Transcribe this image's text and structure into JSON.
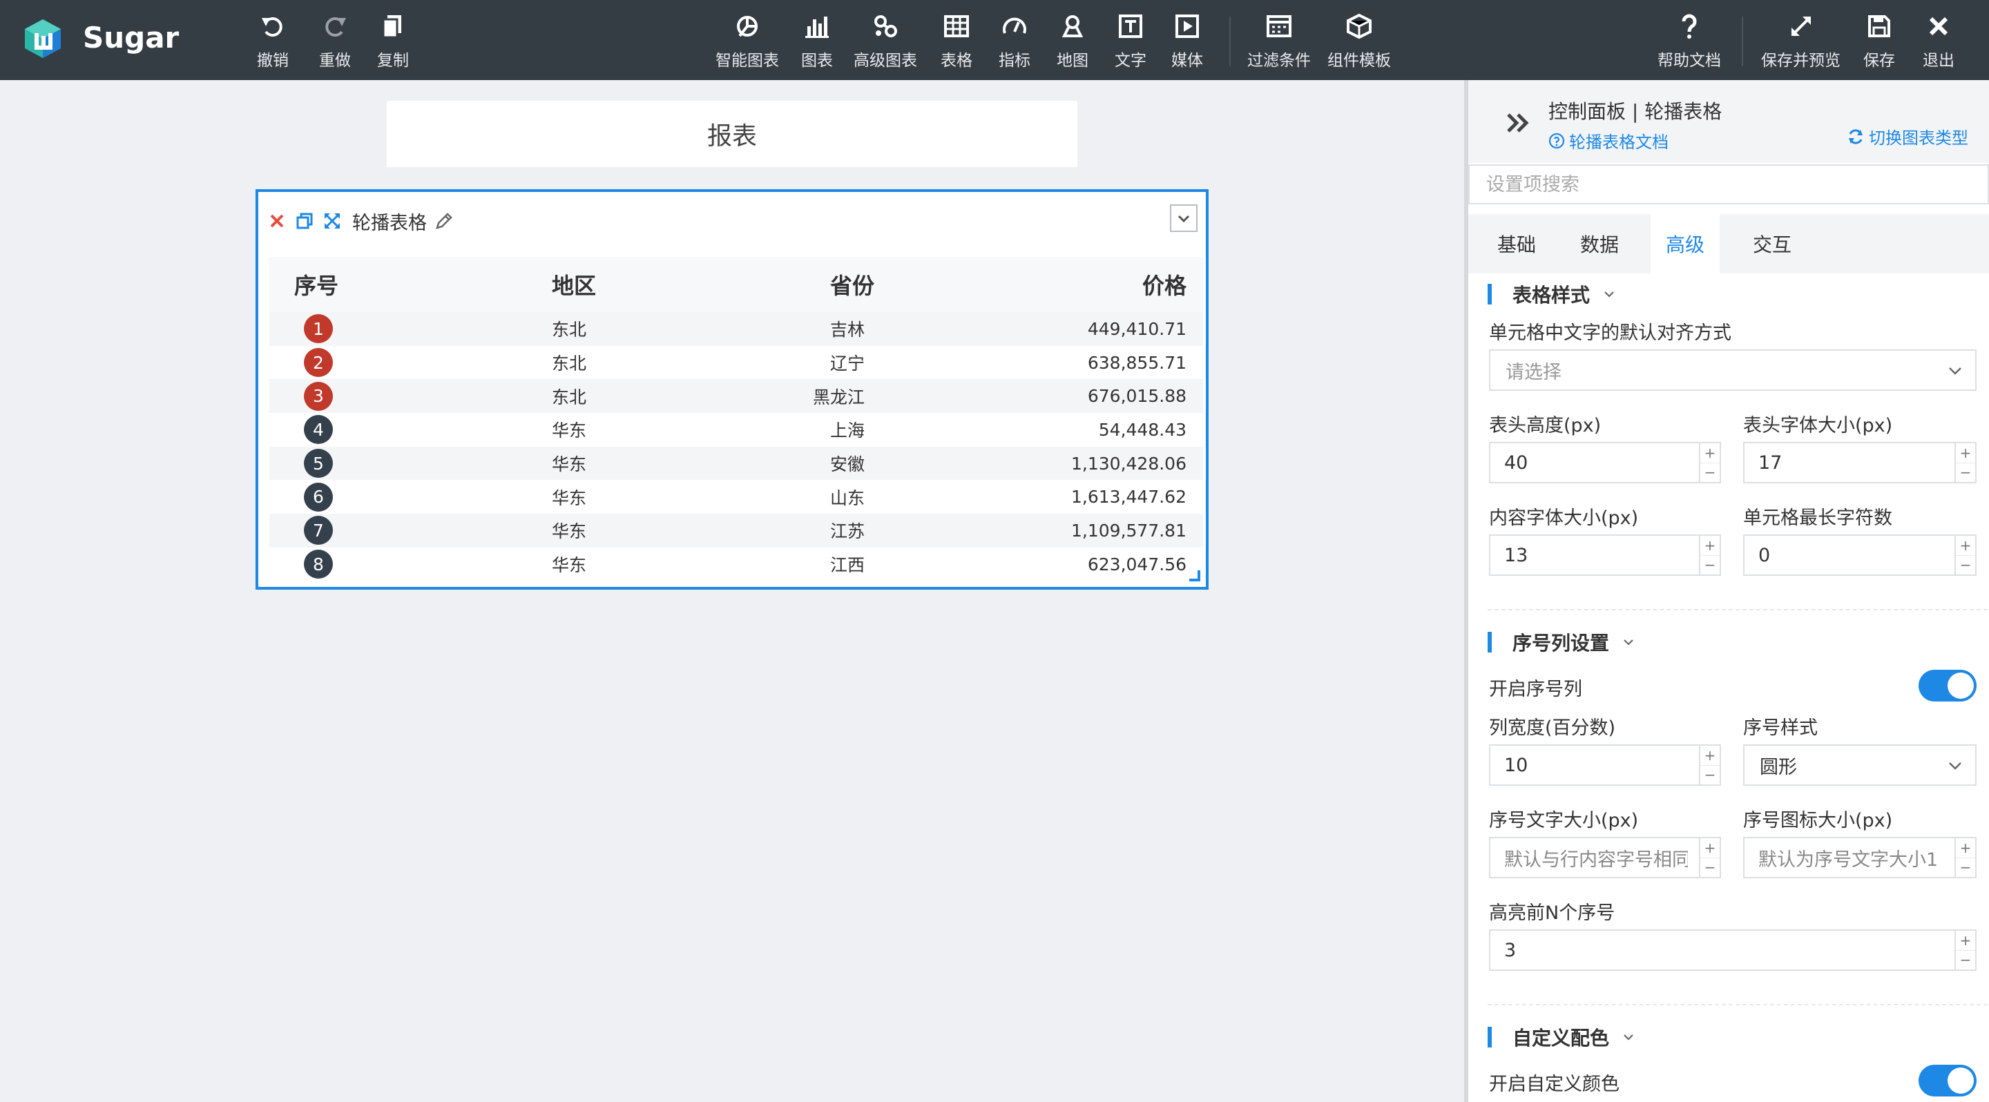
{
  "app": {
    "brand": "Sugar"
  },
  "toolbar_left": [
    {
      "key": "undo",
      "label": "撤销"
    },
    {
      "key": "redo",
      "label": "重做"
    },
    {
      "key": "copy",
      "label": "复制"
    }
  ],
  "toolbar_center": [
    {
      "key": "smart_chart",
      "label": "智能图表"
    },
    {
      "key": "chart",
      "label": "图表"
    },
    {
      "key": "adv_chart",
      "label": "高级图表"
    },
    {
      "key": "table",
      "label": "表格"
    },
    {
      "key": "metric",
      "label": "指标"
    },
    {
      "key": "map",
      "label": "地图"
    },
    {
      "key": "text",
      "label": "文字"
    },
    {
      "key": "media",
      "label": "媒体"
    },
    {
      "key": "filter",
      "label": "过滤条件"
    },
    {
      "key": "template",
      "label": "组件模板"
    }
  ],
  "toolbar_right": [
    {
      "key": "help",
      "label": "帮助文档"
    },
    {
      "key": "save_preview",
      "label": "保存并预览"
    },
    {
      "key": "save",
      "label": "保存"
    },
    {
      "key": "exit",
      "label": "退出"
    }
  ],
  "report": {
    "title": "报表"
  },
  "widget": {
    "title": "轮播表格",
    "columns": [
      "序号",
      "地区",
      "省份",
      "价格"
    ],
    "highlight_color": "#c0392b",
    "normal_color": "#34404c",
    "rows": [
      {
        "idx": "1",
        "region": "东北",
        "province": "吉林",
        "price": "449,410.71",
        "highlight": true
      },
      {
        "idx": "2",
        "region": "东北",
        "province": "辽宁",
        "price": "638,855.71",
        "highlight": true
      },
      {
        "idx": "3",
        "region": "东北",
        "province": "黑龙江",
        "price": "676,015.88",
        "highlight": true
      },
      {
        "idx": "4",
        "region": "华东",
        "province": "上海",
        "price": "54,448.43",
        "highlight": false
      },
      {
        "idx": "5",
        "region": "华东",
        "province": "安徽",
        "price": "1,130,428.06",
        "highlight": false
      },
      {
        "idx": "6",
        "region": "华东",
        "province": "山东",
        "price": "1,613,447.62",
        "highlight": false
      },
      {
        "idx": "7",
        "region": "华东",
        "province": "江苏",
        "price": "1,109,577.81",
        "highlight": false
      },
      {
        "idx": "8",
        "region": "华东",
        "province": "江西",
        "price": "623,047.56",
        "highlight": false
      }
    ]
  },
  "panel": {
    "title": "控制面板 | 轮播表格",
    "doc_link": "轮播表格文档",
    "switch_type": "切换图表类型",
    "search_placeholder": "设置项搜索",
    "tabs": [
      "基础",
      "数据",
      "高级",
      "交互"
    ],
    "active_tab": "高级",
    "table_style": {
      "title": "表格样式",
      "align_label": "单元格中文字的默认对齐方式",
      "align_placeholder": "请选择",
      "header_height_label": "表头高度(px)",
      "header_height": "40",
      "header_font_label": "表头字体大小(px)",
      "header_font": "17",
      "content_font_label": "内容字体大小(px)",
      "content_font": "13",
      "max_chars_label": "单元格最长字符数",
      "max_chars": "0"
    },
    "index_col": {
      "title": "序号列设置",
      "enable_label": "开启序号列",
      "enabled": true,
      "width_label": "列宽度(百分数)",
      "width": "10",
      "style_label": "序号样式",
      "style": "圆形",
      "text_size_label": "序号文字大小(px)",
      "text_size_placeholder": "默认与行内容字号相同",
      "icon_size_label": "序号图标大小(px)",
      "icon_size_placeholder": "默认为序号文字大小1",
      "highlight_label": "高亮前N个序号",
      "highlight_n": "3"
    },
    "custom_color": {
      "title": "自定义配色",
      "enable_label": "开启自定义颜色",
      "enabled": true
    }
  }
}
